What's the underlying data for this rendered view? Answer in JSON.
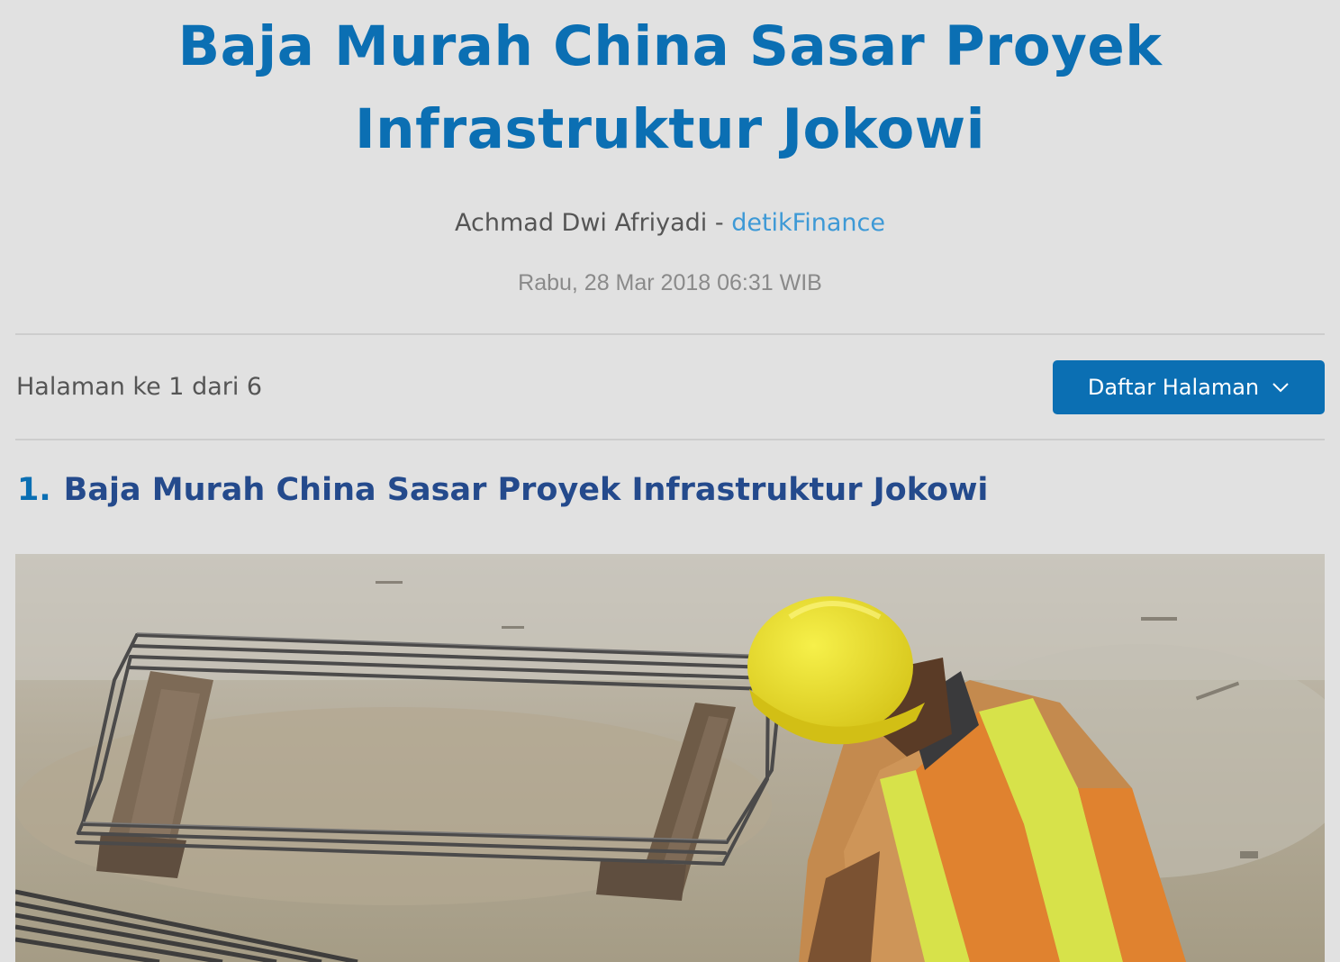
{
  "article": {
    "title_line1": "Baja Murah China Sasar Proyek",
    "title_line2": "Infrastruktur Jokowi",
    "author": "Achmad Dwi Afriyadi",
    "separator": " - ",
    "source": "detikFinance",
    "date": "Rabu, 28 Mar 2018 06:31 WIB"
  },
  "pagination": {
    "info": "Halaman ke 1 dari 6",
    "button_label": "Daftar Halaman",
    "button_icon": "chevron-down-icon"
  },
  "section": {
    "number": "1.",
    "heading": "Baja Murah China Sasar Proyek Infrastruktur Jokowi"
  },
  "image": {
    "subject": "construction-worker-with-yellow-helmet-and-steel-rebar"
  },
  "colors": {
    "accent": "#0b6fb3",
    "heading": "#244a8c",
    "source_link": "#3d99d6",
    "background": "#e1e1e1"
  }
}
